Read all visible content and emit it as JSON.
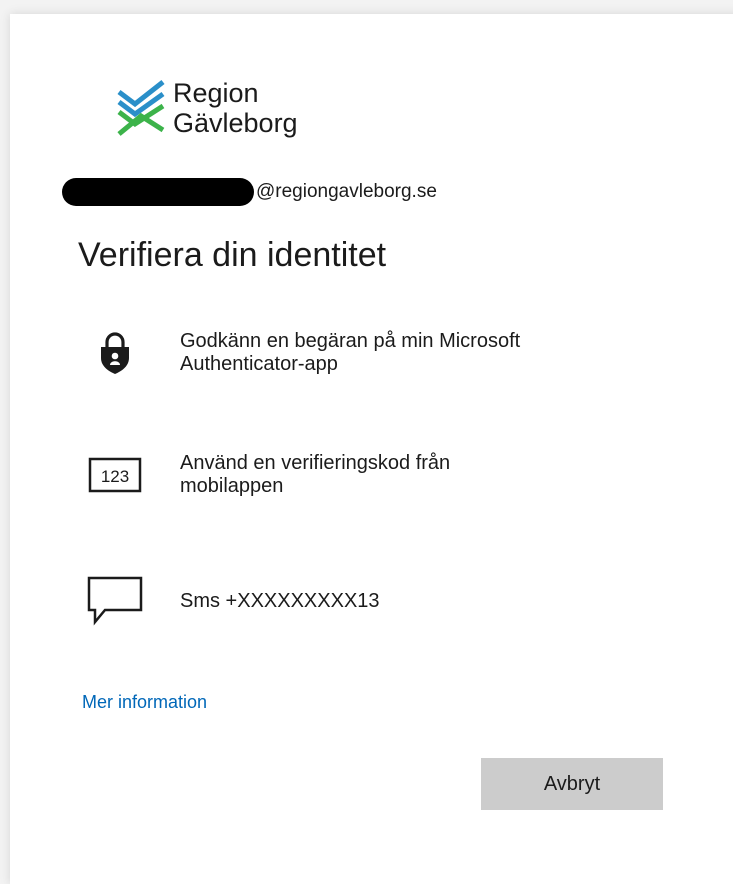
{
  "logo": {
    "line1": "Region",
    "line2": "Gävleborg"
  },
  "account": {
    "domain": "@regiongavleborg.se"
  },
  "title": "Verifiera din identitet",
  "options": [
    {
      "icon": "authenticator-lock-icon",
      "line1": "Godkänn en begäran på min Microsoft",
      "line2": "Authenticator-app"
    },
    {
      "icon": "code-123-icon",
      "line1": "Använd en verifieringskod från",
      "line2": "mobilappen"
    },
    {
      "icon": "sms-chat-icon",
      "line1": "Sms +XXXXXXXXX13",
      "line2": ""
    }
  ],
  "more_info": "Mer information",
  "cancel_label": "Avbryt",
  "colors": {
    "logo_blue": "#2a8fc9",
    "logo_green": "#3cb34a",
    "link": "#0067b8",
    "button_bg": "#cccccc"
  }
}
